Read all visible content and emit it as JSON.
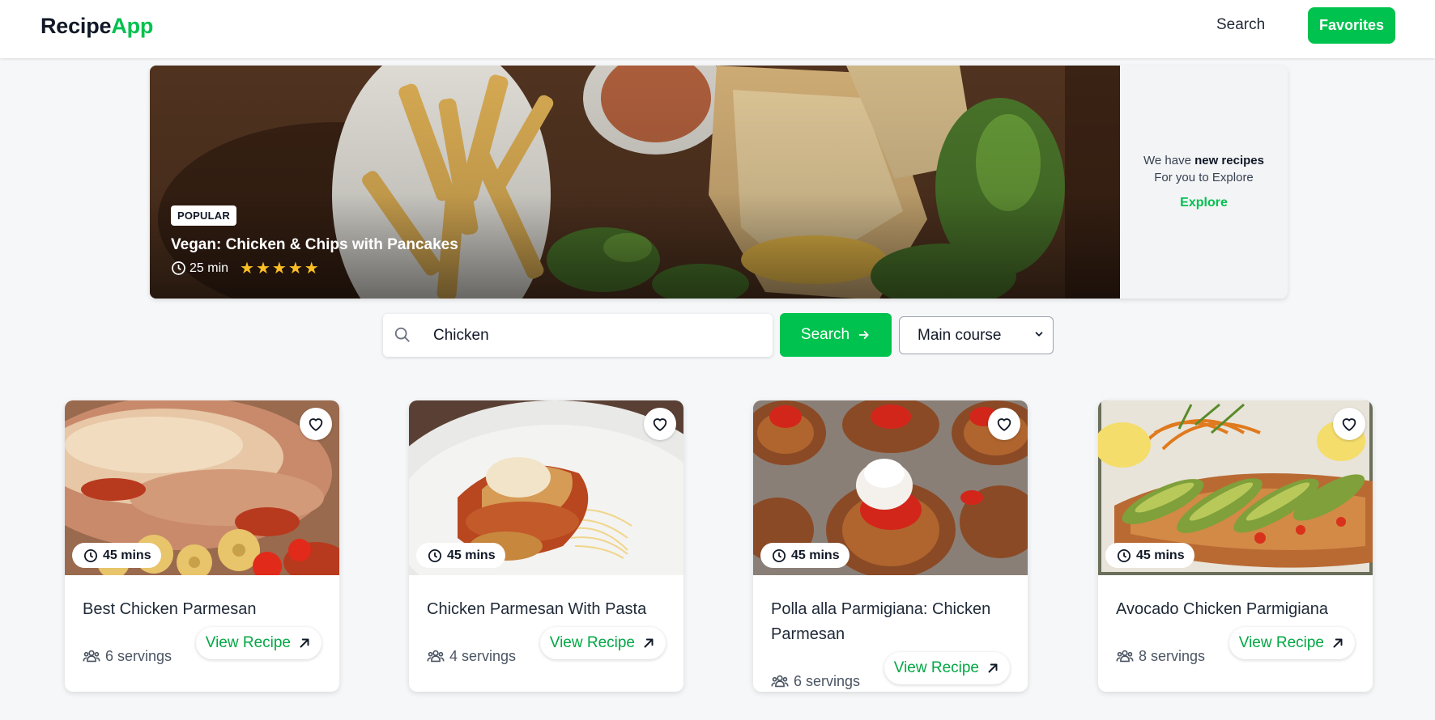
{
  "header": {
    "logo_part1": "Recipe",
    "logo_part2": "App",
    "nav_search": "Search",
    "nav_favorites": "Favorites"
  },
  "hero": {
    "badge": "POPULAR",
    "title": "Vegan: Chicken & Chips with Pancakes",
    "time": "25 min",
    "rating": 5,
    "side_text_prefix": "We have ",
    "side_text_bold": "new recipes",
    "side_text_line2": "For you to Explore",
    "explore_label": "Explore"
  },
  "search": {
    "query": "Chicken",
    "button_label": "Search",
    "category_selected": "Main course"
  },
  "recipes": [
    {
      "title": "Best Chicken Parmesan",
      "time": "45 mins",
      "servings": "6 servings",
      "view_label": "View Recipe"
    },
    {
      "title": "Chicken Parmesan With Pasta",
      "time": "45 mins",
      "servings": "4 servings",
      "view_label": "View Recipe"
    },
    {
      "title": "Polla alla Parmigiana: Chicken Parmesan",
      "time": "45 mins",
      "servings": "6 servings",
      "view_label": "View Recipe"
    },
    {
      "title": "Avocado Chicken Parmigiana",
      "time": "45 mins",
      "servings": "8 servings",
      "view_label": "View Recipe"
    }
  ],
  "colors": {
    "brand_green": "#00c24e",
    "star_yellow": "#fbbf24"
  },
  "icons": [
    "search-icon",
    "clock-icon",
    "star-icon",
    "heart-icon",
    "users-icon",
    "arrow-up-right-icon",
    "arrow-right-icon",
    "chevron-down-icon"
  ]
}
